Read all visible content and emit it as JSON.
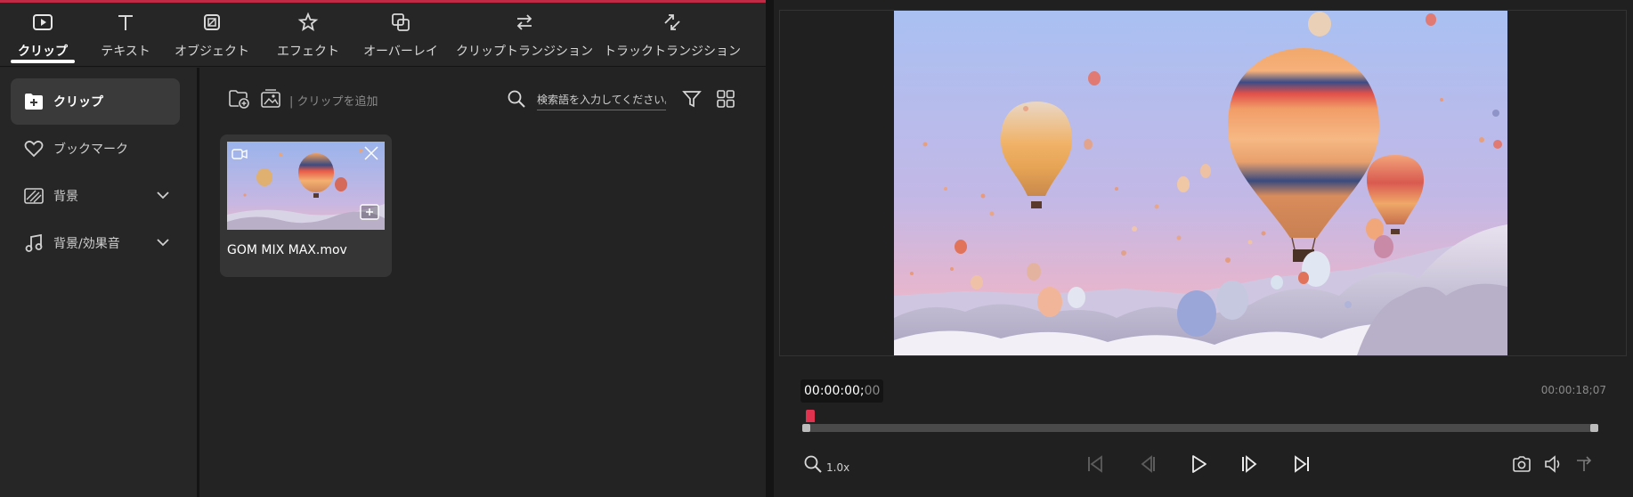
{
  "tabs": [
    {
      "label": "クリップ",
      "icon": "clip-icon",
      "active": true
    },
    {
      "label": "テキスト",
      "icon": "text-icon",
      "active": false
    },
    {
      "label": "オブジェクト",
      "icon": "object-icon",
      "active": false
    },
    {
      "label": "エフェクト",
      "icon": "effect-star-icon",
      "active": false
    },
    {
      "label": "オーバーレイ",
      "icon": "overlay-icon",
      "active": false
    },
    {
      "label": "クリップトランジション",
      "icon": "swap-arrows-icon",
      "active": false
    },
    {
      "label": "トラックトランジション",
      "icon": "diagonal-arrows-icon",
      "active": false
    }
  ],
  "sidebar": {
    "items": [
      {
        "label": "クリップ",
        "icon": "folder-plus-icon",
        "active": true
      },
      {
        "label": "ブックマーク",
        "icon": "heart-icon",
        "active": false
      },
      {
        "label": "背景",
        "icon": "background-pattern-icon",
        "active": false,
        "expandable": true
      },
      {
        "label": "背景/効果音",
        "icon": "music-note-icon",
        "active": false,
        "expandable": true
      }
    ]
  },
  "content": {
    "add_clip_label": "| クリップを追加",
    "search_placeholder": "検索語を入力してください。",
    "clips": [
      {
        "name": "GOM MIX MAX.mov"
      }
    ]
  },
  "player": {
    "timecode_main": "00:00:00;",
    "timecode_frames": "00",
    "duration": "00:00:18;07",
    "speed": "1.0x",
    "progress": 0
  },
  "colors": {
    "accent": "#e0334f",
    "background": "#1e1e1e",
    "panel": "#262626"
  }
}
